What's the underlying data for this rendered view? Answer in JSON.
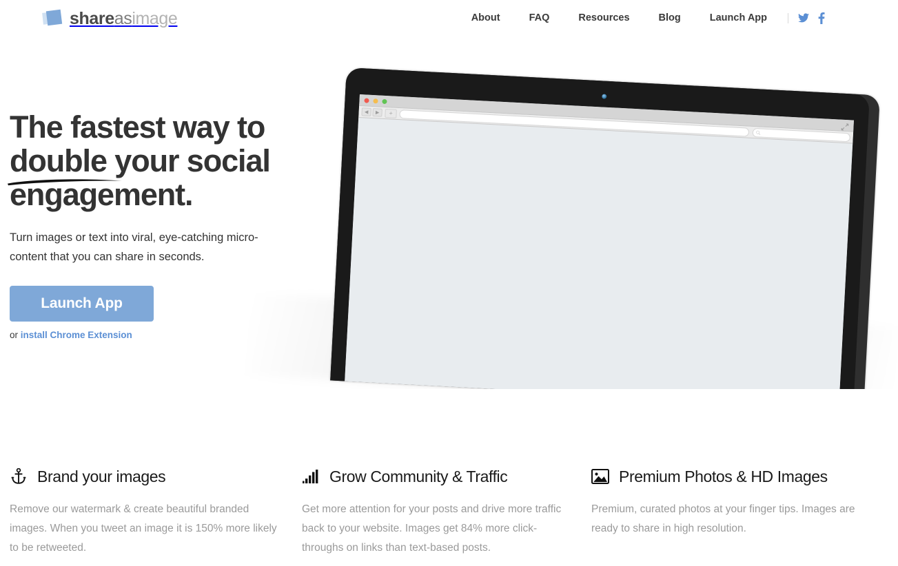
{
  "brand": {
    "part1": "share",
    "part2": "as",
    "part3": "image",
    "logo_icon": "tilted-squares-logo",
    "accent_color": "#7fa8d8"
  },
  "nav": {
    "items": [
      {
        "label": "About",
        "name": "nav-about"
      },
      {
        "label": "FAQ",
        "name": "nav-faq"
      },
      {
        "label": "Resources",
        "name": "nav-resources"
      },
      {
        "label": "Blog",
        "name": "nav-blog"
      },
      {
        "label": "Launch App",
        "name": "nav-launch-app"
      }
    ],
    "social": [
      {
        "icon": "twitter-icon",
        "color": "#5b8fd4"
      },
      {
        "icon": "facebook-icon",
        "color": "#5b8fd4"
      }
    ]
  },
  "hero": {
    "headline_line1": "The fastest way to",
    "headline_emphasis": "double",
    "headline_line2_rest": " your social",
    "headline_line3": "engagement.",
    "subtext": "Turn images or text into viral, eye-catching micro-content that you can share in seconds.",
    "cta_label": "Launch App",
    "cta_color": "#7fa8d8",
    "extension_prefix": "or ",
    "extension_link": "install Chrome Extension",
    "extension_link_color": "#5b8fd4"
  },
  "laptop": {
    "screen_bg": "#e8ecef",
    "bezel_color": "#1a1a1a",
    "browser": {
      "traffic_lights": [
        "#f05a4f",
        "#f5bd4f",
        "#61c454"
      ],
      "back_glyph": "◀",
      "forward_glyph": "▶",
      "new_tab_glyph": "+",
      "url_value": "",
      "search_value": "",
      "search_icon": "magnifier-icon",
      "resize_icon": "fullscreen-arrows-icon"
    }
  },
  "features": [
    {
      "icon": "anchor-icon",
      "title": "Brand your images",
      "body": "Remove our watermark & create beautiful branded images. When you tweet an image it is 150% more likely to be retweeted."
    },
    {
      "icon": "signal-bars-icon",
      "title": "Grow Community & Traffic",
      "body": "Get more attention for your posts and drive more traffic back to your website. Images get 84% more click-throughs on links than text-based posts."
    },
    {
      "icon": "picture-icon",
      "title": "Premium Photos & HD Images",
      "body": "Premium, curated photos at your finger tips. Images are ready to share in high resolution."
    }
  ]
}
